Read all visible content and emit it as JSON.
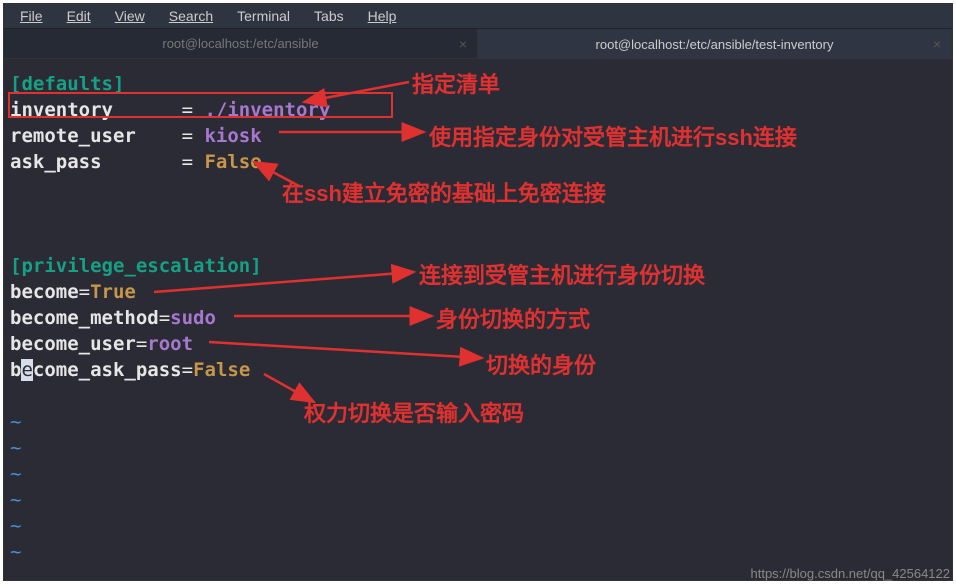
{
  "menu": [
    "File",
    "Edit",
    "View",
    "Search",
    "Terminal",
    "Tabs",
    "Help"
  ],
  "tabs": [
    {
      "title": "root@localhost:/etc/ansible",
      "active": false
    },
    {
      "title": "root@localhost:/etc/ansible/test-inventory",
      "active": true
    }
  ],
  "code": {
    "section1": "[defaults]",
    "l1_key": "inventory",
    "l1_val": "./inventory",
    "l2_key": "remote_user",
    "l2_val": "kiosk",
    "l3_key": "ask_pass",
    "l3_val": "False",
    "section2": "[privilege_escalation]",
    "l4_key": "become",
    "l4_val": "True",
    "l5_key": "become_method",
    "l5_val": "sudo",
    "l6_key": "become_user",
    "l6_val": "root",
    "l7_pre": "b",
    "l7_cursor": "e",
    "l7_rest": "come_ask_pass",
    "l7_val": "False",
    "tilde": "~"
  },
  "annotations": {
    "a1": "指定清单",
    "a2": "使用指定身份对受管主机进行ssh连接",
    "a3": "在ssh建立免密的基础上免密连接",
    "a4": "连接到受管主机进行身份切换",
    "a5": "身份切换的方式",
    "a6": "切换的身份",
    "a7": "权力切换是否输入密码"
  },
  "watermark": "https://blog.csdn.net/qq_42564122"
}
